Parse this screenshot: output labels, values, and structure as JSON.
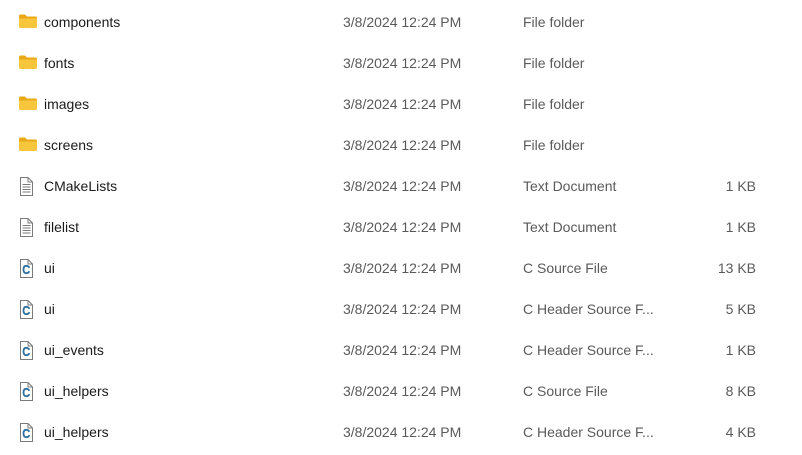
{
  "colors": {
    "folder_main": "#f8c63d",
    "folder_tab": "#e8a817",
    "doc_stroke": "#7a7a7a",
    "c_file_accent": "#2f6f9f"
  },
  "files": [
    {
      "name": "components",
      "date": "3/8/2024 12:24 PM",
      "type": "File folder",
      "size": "",
      "icon": "folder-icon"
    },
    {
      "name": "fonts",
      "date": "3/8/2024 12:24 PM",
      "type": "File folder",
      "size": "",
      "icon": "folder-icon"
    },
    {
      "name": "images",
      "date": "3/8/2024 12:24 PM",
      "type": "File folder",
      "size": "",
      "icon": "folder-icon"
    },
    {
      "name": "screens",
      "date": "3/8/2024 12:24 PM",
      "type": "File folder",
      "size": "",
      "icon": "folder-icon"
    },
    {
      "name": "CMakeLists",
      "date": "3/8/2024 12:24 PM",
      "type": "Text Document",
      "size": "1 KB",
      "icon": "text-document-icon"
    },
    {
      "name": "filelist",
      "date": "3/8/2024 12:24 PM",
      "type": "Text Document",
      "size": "1 KB",
      "icon": "text-document-icon"
    },
    {
      "name": "ui",
      "date": "3/8/2024 12:24 PM",
      "type": "C Source File",
      "size": "13 KB",
      "icon": "c-source-icon"
    },
    {
      "name": "ui",
      "date": "3/8/2024 12:24 PM",
      "type": "C Header Source F...",
      "size": "5 KB",
      "icon": "c-header-icon"
    },
    {
      "name": "ui_events",
      "date": "3/8/2024 12:24 PM",
      "type": "C Header Source F...",
      "size": "1 KB",
      "icon": "c-header-icon"
    },
    {
      "name": "ui_helpers",
      "date": "3/8/2024 12:24 PM",
      "type": "C Source File",
      "size": "8 KB",
      "icon": "c-source-icon"
    },
    {
      "name": "ui_helpers",
      "date": "3/8/2024 12:24 PM",
      "type": "C Header Source F...",
      "size": "4 KB",
      "icon": "c-header-icon"
    }
  ]
}
